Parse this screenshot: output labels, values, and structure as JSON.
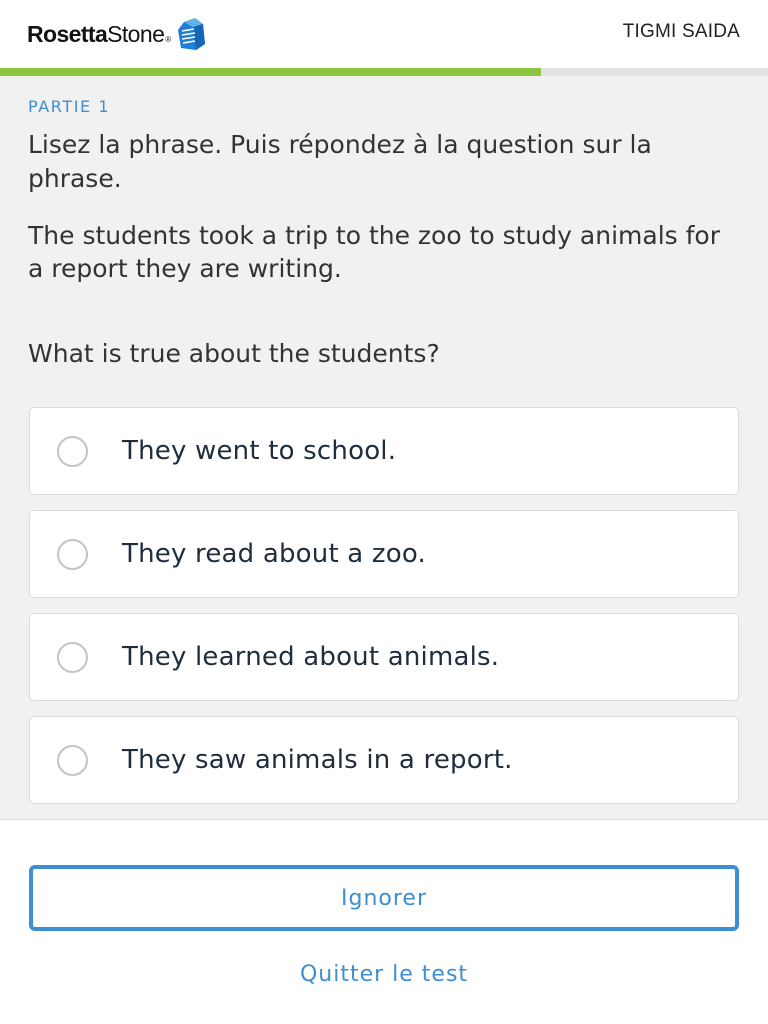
{
  "header": {
    "brand_light": "Rosetta",
    "brand_stone": "Stone",
    "brand_reg": "®",
    "user_name": "TIGMI SAIDA"
  },
  "progress": {
    "fraction": 0.705,
    "fill_color": "#8cc63f",
    "track_color": "#e3e3e3"
  },
  "exercise": {
    "section_label": "PARTIE 1",
    "instruction": "Lisez la phrase. Puis répondez à la question sur la phrase.",
    "passage": "The students took a trip to the zoo to study animals for a report they are writing.",
    "question": "What is true about the students?",
    "options": [
      {
        "label": "They went to school."
      },
      {
        "label": "They read about a zoo."
      },
      {
        "label": "They learned about animals."
      },
      {
        "label": "They saw animals in a report."
      }
    ]
  },
  "footer": {
    "skip_label": "Ignorer",
    "quit_label": "Quitter le test"
  },
  "colors": {
    "accent": "#3d8fd1",
    "background": "#f1f1f1"
  },
  "icons": {
    "logo": "rosetta-stone-mark-icon",
    "option": "radio-unchecked-icon"
  }
}
